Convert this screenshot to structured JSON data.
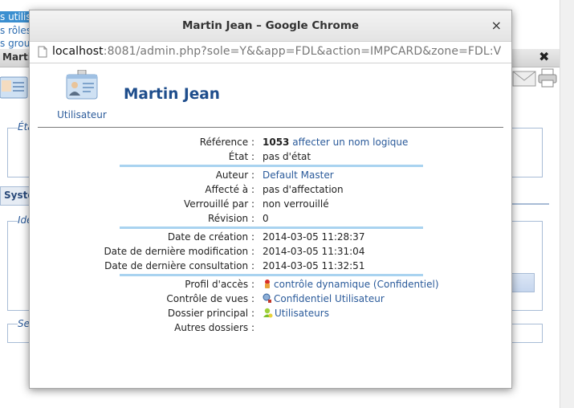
{
  "background": {
    "left_links": [
      "s utilisa",
      "s rôles",
      "s group"
    ],
    "strip_title": "Marti",
    "strip_close": "✖",
    "labels": [
      "Éta",
      "Ide",
      "Se"
    ],
    "tab_label": "Systè"
  },
  "window": {
    "title": "Martin Jean – Google Chrome",
    "close_label": "×",
    "url_host": "localhost",
    "url_rest": ":8081/admin.php?sole=Y&&app=FDL&action=IMPCARD&zone=FDL:V"
  },
  "card": {
    "icon_caption": "Utilisateur",
    "title": "Martin Jean",
    "reference_label": "Référence :",
    "reference_number": "1053",
    "reference_link": "affecter un nom logique",
    "state_label": "État :",
    "state_value": "pas d'état",
    "author_label": "Auteur :",
    "author_value": "Default Master",
    "assigned_label": "Affecté à :",
    "assigned_value": "pas d'affectation",
    "locked_label": "Verrouillé par :",
    "locked_value": "non verrouillé",
    "revision_label": "Révision :",
    "revision_value": "0",
    "created_label": "Date de création :",
    "created_value": "2014-03-05 11:28:37",
    "modified_label": "Date de dernière modification :",
    "modified_value": "2014-03-05 11:31:04",
    "consulted_label": "Date de dernière consultation :",
    "consulted_value": "2014-03-05 11:32:51",
    "profile_label": "Profil d'accès :",
    "profile_value": "contrôle dynamique (Confidentiel)",
    "views_label": "Contrôle de vues :",
    "views_value": "Confidentiel Utilisateur",
    "folder_label": "Dossier principal :",
    "folder_value": "Utilisateurs",
    "other_folders_label": "Autres dossiers :"
  }
}
